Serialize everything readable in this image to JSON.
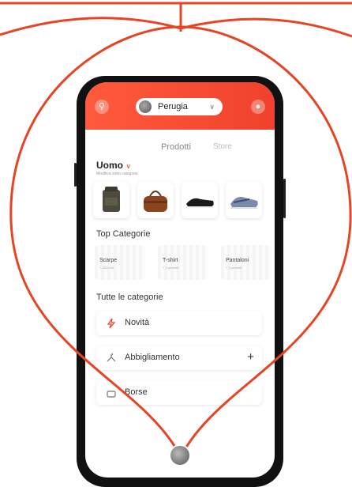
{
  "header": {
    "city": "Perugia",
    "left_icon": "search-icon",
    "right_icon": "notification-icon",
    "chevron_icon": "chevron-down-icon"
  },
  "tabs": [
    {
      "label": "Prodotti",
      "active": true
    },
    {
      "label": "Store",
      "active": false
    }
  ],
  "category": {
    "title": "Uomo",
    "subtitle": "Modifica sotto categorie"
  },
  "products": [
    "backpack",
    "leather-bag",
    "black-sneaker",
    "grey-sneaker"
  ],
  "top_categories": {
    "title": "Top Categorie",
    "items": [
      {
        "label": "Scarpe",
        "sub": "+ 2324 Art."
      },
      {
        "label": "T-shirt",
        "sub": "+ 2 prodotti"
      },
      {
        "label": "Pantaloni",
        "sub": "+ 3 prodotti"
      }
    ]
  },
  "all_categories": {
    "title": "Tutte le categorie",
    "items": [
      {
        "label": "Novità",
        "icon": "lightning-icon"
      },
      {
        "label": "Abbigliamento",
        "icon": "hanger-icon",
        "expand": "+"
      },
      {
        "label": "Borse",
        "icon": "bag-icon"
      }
    ]
  },
  "colors": {
    "accent": "#f0412c",
    "line": "#e64524"
  }
}
